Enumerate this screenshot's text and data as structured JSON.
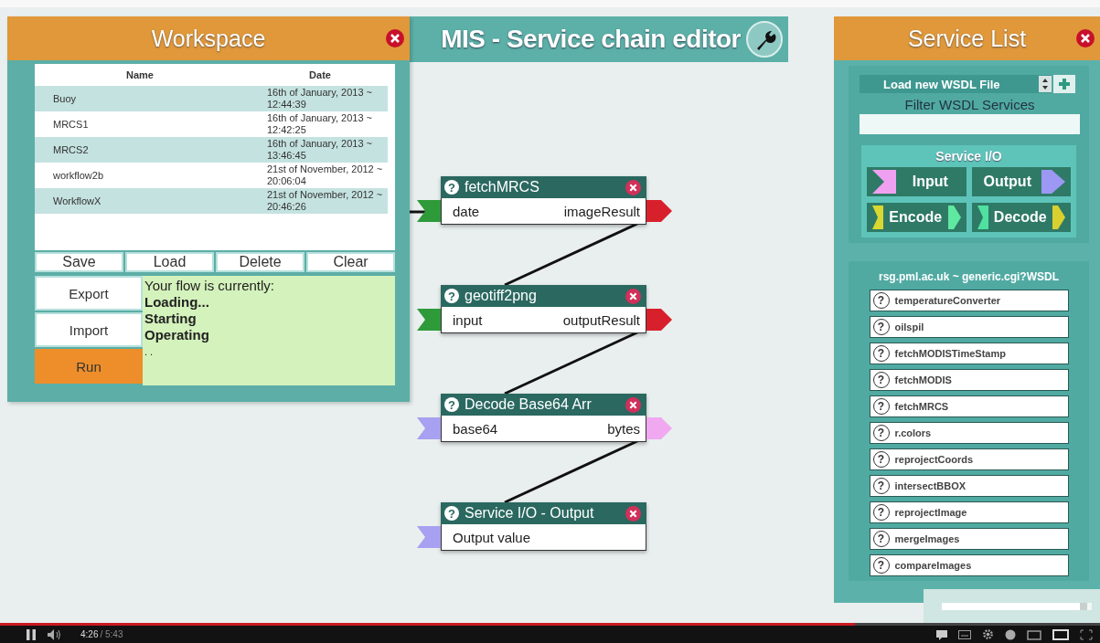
{
  "workspace": {
    "title": "Workspace",
    "columns": [
      "Name",
      "Date"
    ],
    "rows": [
      {
        "name": "Buoy",
        "date": "16th of January, 2013 ~ 12:44:39"
      },
      {
        "name": "MRCS1",
        "date": "16th of January, 2013 ~ 12:42:25"
      },
      {
        "name": "MRCS2",
        "date": "16th of January, 2013 ~ 13:46:45"
      },
      {
        "name": "workflow2b",
        "date": "21st of November, 2012 ~ 20:06:04"
      },
      {
        "name": "WorkflowX",
        "date": "21st of November, 2012 ~ 20:46:26"
      }
    ],
    "buttons": [
      "Save",
      "Load",
      "Delete",
      "Clear"
    ],
    "side_buttons": [
      {
        "label": "Export",
        "kind": "plain"
      },
      {
        "label": "Import",
        "kind": "plain"
      },
      {
        "label": "Run",
        "kind": "primary"
      }
    ],
    "status": {
      "heading": "Your flow is currently:",
      "steps": [
        "Loading...",
        "Starting",
        "Operating"
      ],
      "more": ". ."
    }
  },
  "editor": {
    "title": "MIS - Service chain editor"
  },
  "nodes": [
    {
      "help": "?",
      "title": "fetchMRCS",
      "input": {
        "name": "date",
        "color": "#2e9a3a"
      },
      "output": {
        "name": "imageResult",
        "color": "#d8202c"
      }
    },
    {
      "help": "?",
      "title": "geotiff2png",
      "input": {
        "name": "input",
        "color": "#2e9a3a"
      },
      "output": {
        "name": "outputResult",
        "color": "#d8202c"
      }
    },
    {
      "help": "?",
      "title": "Decode Base64 Arr",
      "input": {
        "name": "base64",
        "color": "#a8a0f0"
      },
      "output": {
        "name": "bytes",
        "color": "#f0a8f0"
      }
    },
    {
      "help": "?",
      "title": "Service I/O - Output",
      "input": {
        "name": "Output value",
        "color": "#a8a0f0"
      }
    }
  ],
  "service_list": {
    "title": "Service List",
    "select": {
      "value": "Load new WSDL File"
    },
    "filter": {
      "label": "Filter WSDL Services"
    },
    "io": {
      "title": "Service I/O",
      "buttons": [
        {
          "label": "Input",
          "in_flag": {
            "color": "#f0a0f0"
          }
        },
        {
          "label": "Output",
          "out_arrow": {
            "color": "#9c98f4"
          }
        },
        {
          "label": "Encode",
          "in_flag": {
            "color": "#d8d830"
          },
          "out_arrow": {
            "color": "#60e8a0"
          }
        },
        {
          "label": "Decode",
          "in_flag": {
            "color": "#50e0a0"
          },
          "out_arrow": {
            "color": "#d8d030"
          }
        }
      ]
    },
    "source": "rsg.pml.ac.uk ~ generic.cgi?WSDL",
    "services": [
      {
        "help": "?",
        "name": "temperatureConverter"
      },
      {
        "help": "?",
        "name": "oilspil"
      },
      {
        "help": "?",
        "name": "fetchMODISTimeStamp"
      },
      {
        "help": "?",
        "name": "fetchMODIS"
      },
      {
        "help": "?",
        "name": "fetchMRCS"
      },
      {
        "help": "?",
        "name": "r.colors"
      },
      {
        "help": "?",
        "name": "reprojectCoords"
      },
      {
        "help": "?",
        "name": "intersectBBOX"
      },
      {
        "help": "?",
        "name": "reprojectImage"
      },
      {
        "help": "?",
        "name": "mergeImages"
      },
      {
        "help": "?",
        "name": "compareImages"
      }
    ]
  },
  "zoom_slider": {
    "level": 0.97
  },
  "player": {
    "progress": {
      "level": 0.777
    },
    "time_current": "4:26",
    "time_total": "/ 5:43"
  }
}
